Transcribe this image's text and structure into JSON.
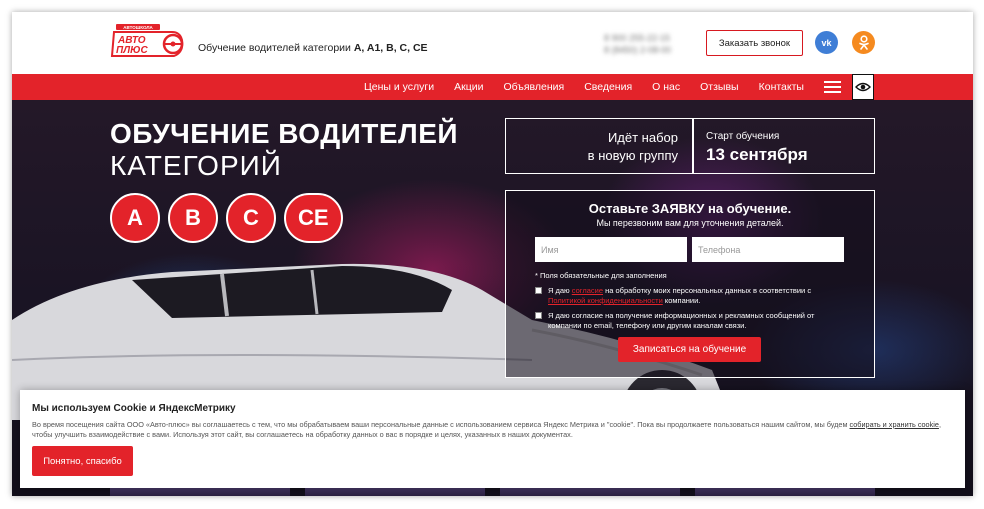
{
  "header": {
    "logo_text_top": "АВТОШКОЛА",
    "logo_text_main": "АВТО ПЛЮС",
    "tagline_prefix": "Обучение водителей категории",
    "tagline_cats": "A, A1, B, C, CE",
    "phone1": "8 900 255-22-15",
    "phone2": "8 (8450) 2-08-00",
    "call_button": "Заказать звонок",
    "vk_label": "vk",
    "icons": {
      "vk": "vk-icon",
      "ok": "odnoklassniki-icon"
    }
  },
  "nav": {
    "items": [
      {
        "label": "Цены и услуги"
      },
      {
        "label": "Акции"
      },
      {
        "label": "Объявления"
      },
      {
        "label": "Сведения"
      },
      {
        "label": "О нас"
      },
      {
        "label": "Отзывы"
      },
      {
        "label": "Контакты"
      }
    ],
    "icons": {
      "menu": "hamburger-icon",
      "accessibility": "eye-icon"
    }
  },
  "hero": {
    "title_line1": "ОБУЧЕНИЕ ВОДИТЕЛЕЙ",
    "title_line2": "КАТЕГОРИЙ",
    "categories": [
      "A",
      "B",
      "C",
      "CE"
    ],
    "recruit_line1": "Идёт набор",
    "recruit_line2": "в новую группу",
    "start_label": "Старт обучения",
    "start_date": "13 сентября"
  },
  "form": {
    "title": "Оставьте ЗАЯВКУ на обучение.",
    "subtitle": "Мы перезвоним вам для уточнения деталей.",
    "name_placeholder": "Имя",
    "phone_placeholder": "Телефона",
    "required_note": "* Поля обязательные для заполнения",
    "consent1_a": "Я даю ",
    "consent1_link1": "согласие",
    "consent1_b": " на обработку моих персональных данных в соответствии с ",
    "consent1_link2": "Политикой конфиденциальности",
    "consent1_c": " компании.",
    "consent2": "Я даю согласие на получение информационных и рекламных сообщений от компании по email, телефону или другим каналам связи.",
    "submit": "Записаться на обучение"
  },
  "cookie": {
    "title": "Мы используем Cookie и ЯндексМетрику",
    "text_a": "Во время посещения сайта ООО «Авто-плюс» вы соглашаетесь с тем, что мы обрабатываем ваши персональные данные с использованием сервиса Яндекс Метрика и \"cookie\". Пока вы продолжаете пользоваться нашим сайтом, мы будем ",
    "text_link": "собирать и хранить cookie",
    "text_b": ", чтобы улучшить взаимодействие с вами. Используя этот сайт, вы соглашаетесь на обработку данных о вас в порядке и целях, указанных в наших документах.",
    "button": "Понятно, спасибо"
  },
  "colors": {
    "accent": "#e3232a",
    "vk": "#3f7ed6",
    "ok": "#f58a1f"
  }
}
